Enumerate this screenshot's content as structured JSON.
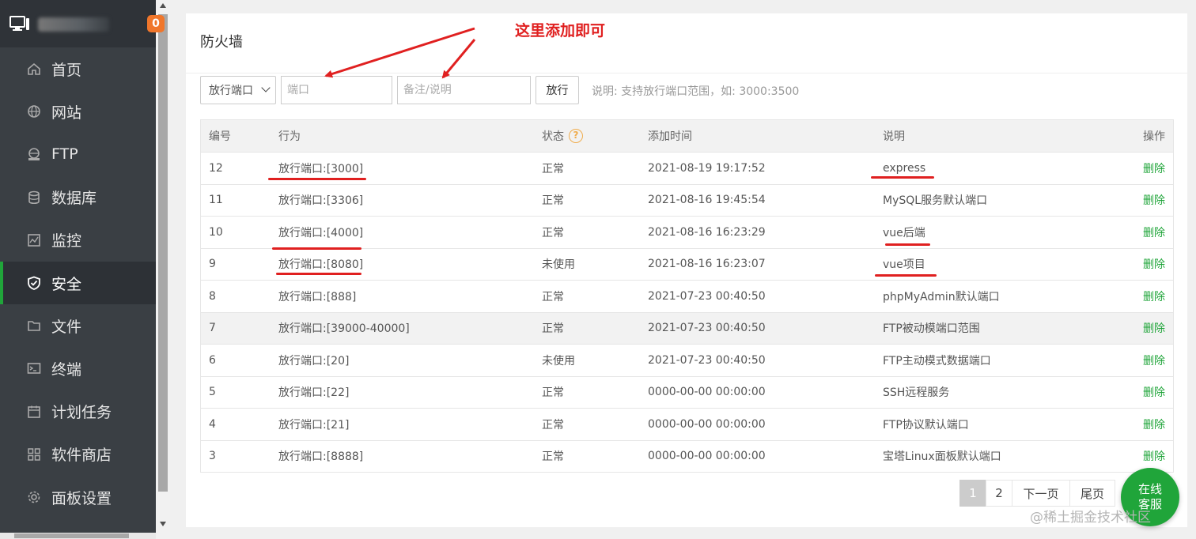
{
  "sidebar": {
    "badge": "0",
    "items": [
      {
        "label": "首页",
        "icon": "home-icon"
      },
      {
        "label": "网站",
        "icon": "globe-icon"
      },
      {
        "label": "FTP",
        "icon": "ftp-icon"
      },
      {
        "label": "数据库",
        "icon": "database-icon"
      },
      {
        "label": "监控",
        "icon": "monitor-icon"
      },
      {
        "label": "安全",
        "icon": "shield-icon",
        "active": true
      },
      {
        "label": "文件",
        "icon": "folder-icon"
      },
      {
        "label": "终端",
        "icon": "terminal-icon"
      },
      {
        "label": "计划任务",
        "icon": "calendar-icon"
      },
      {
        "label": "软件商店",
        "icon": "apps-icon"
      },
      {
        "label": "面板设置",
        "icon": "gear-icon"
      }
    ]
  },
  "page": {
    "title": "防火墙",
    "annotation": "这里添加即可"
  },
  "toolbar": {
    "select_value": "放行端口",
    "port_placeholder": "端口",
    "note_placeholder": "备注/说明",
    "allow_label": "放行",
    "hint": "说明: 支持放行端口范围，如: 3000:3500"
  },
  "table": {
    "headers": {
      "no": "编号",
      "action": "行为",
      "status": "状态",
      "help": "?",
      "time": "添加时间",
      "note": "说明",
      "op": "操作"
    },
    "rows": [
      {
        "no": "12",
        "action": "放行端口:[3000]",
        "status": "正常",
        "time": "2021-08-19 19:17:52",
        "note": "express",
        "op": "删除"
      },
      {
        "no": "11",
        "action": "放行端口:[3306]",
        "status": "正常",
        "time": "2021-08-16 19:45:54",
        "note": "MySQL服务默认端口",
        "op": "删除"
      },
      {
        "no": "10",
        "action": "放行端口:[4000]",
        "status": "正常",
        "time": "2021-08-16 16:23:29",
        "note": "vue后端",
        "op": "删除"
      },
      {
        "no": "9",
        "action": "放行端口:[8080]",
        "status": "未使用",
        "time": "2021-08-16 16:23:07",
        "note": "vue项目",
        "op": "删除"
      },
      {
        "no": "8",
        "action": "放行端口:[888]",
        "status": "正常",
        "time": "2021-07-23 00:40:50",
        "note": "phpMyAdmin默认端口",
        "op": "删除"
      },
      {
        "no": "7",
        "action": "放行端口:[39000-40000]",
        "status": "正常",
        "time": "2021-07-23 00:40:50",
        "note": "FTP被动模端口范围",
        "op": "删除"
      },
      {
        "no": "6",
        "action": "放行端口:[20]",
        "status": "未使用",
        "time": "2021-07-23 00:40:50",
        "note": "FTP主动模式数据端口",
        "op": "删除"
      },
      {
        "no": "5",
        "action": "放行端口:[22]",
        "status": "正常",
        "time": "0000-00-00 00:00:00",
        "note": "SSH远程服务",
        "op": "删除"
      },
      {
        "no": "4",
        "action": "放行端口:[21]",
        "status": "正常",
        "time": "0000-00-00 00:00:00",
        "note": "FTP协议默认端口",
        "op": "删除"
      },
      {
        "no": "3",
        "action": "放行端口:[8888]",
        "status": "正常",
        "time": "0000-00-00 00:00:00",
        "note": "宝塔Linux面板默认端口",
        "op": "删除"
      }
    ]
  },
  "pager": {
    "pages": [
      "1",
      "2"
    ],
    "next": "下一页",
    "last": "尾页"
  },
  "chat": {
    "line1": "在线",
    "line2": "客服"
  },
  "watermark": "@稀土掘金技术社区",
  "colors": {
    "accent": "#20a53a",
    "annotation": "#e02020",
    "sidebar": "#3a3f44"
  }
}
